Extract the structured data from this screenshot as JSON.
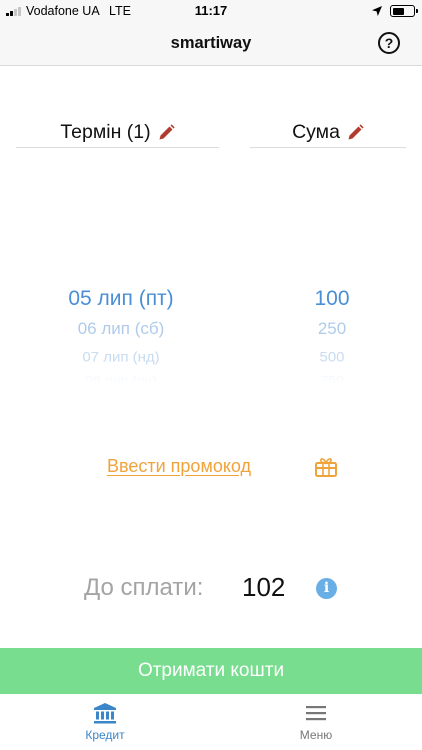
{
  "status_bar": {
    "carrier": "Vodafone UA",
    "network": "LTE",
    "time": "11:17",
    "battery_level": 0.6
  },
  "header": {
    "title": "smartiway",
    "help_label": "?"
  },
  "columns": {
    "term_label": "Термін (1)",
    "sum_label": "Сума"
  },
  "date_picker": {
    "selected": "05 лип (пт)",
    "options": [
      "06 лип (сб)",
      "07 лип (нд)",
      "08 лип (пн)"
    ]
  },
  "sum_picker": {
    "selected": "100",
    "options": [
      "250",
      "500",
      "750"
    ]
  },
  "promo": {
    "label": "Ввести промокод"
  },
  "payment": {
    "label": "До сплати:",
    "amount": "102",
    "info_label": "i"
  },
  "cta": {
    "label": "Отримати кошти"
  },
  "tabs": [
    {
      "label": "Кредит",
      "active": true
    },
    {
      "label": "Меню",
      "active": false
    }
  ],
  "colors": {
    "accent_blue": "#4a8fd6",
    "promo_orange": "#f0a33b",
    "cta_green": "#78dd8f",
    "pencil_red": "#b13b2e",
    "info_blue": "#6aaee6"
  },
  "icons": {
    "edit": "pencil-icon",
    "help": "question-circle-icon",
    "promo": "gift-icon",
    "info": "info-icon",
    "credit_tab": "bank-icon",
    "menu_tab": "hamburger-icon"
  }
}
